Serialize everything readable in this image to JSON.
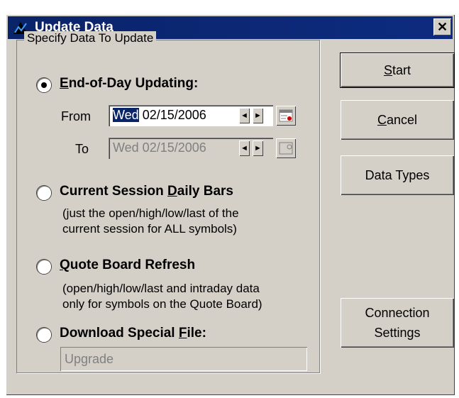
{
  "window": {
    "title": "Update Data",
    "close_glyph": "✕"
  },
  "group": {
    "title": "Specify Data To Update"
  },
  "options": [
    {
      "label_pre": "",
      "label_u": "E",
      "label_post": "nd-of-Day Updating:",
      "selected": true
    },
    {
      "label_pre": "Current Session ",
      "label_u": "D",
      "label_post": "aily Bars",
      "selected": false,
      "desc1": "(just the open/high/low/last of the",
      "desc2": "current session for ALL symbols)"
    },
    {
      "label_pre": "",
      "label_u": "Q",
      "label_post": "uote Board Refresh",
      "selected": false,
      "desc1": "(open/high/low/last and intraday data",
      "desc2": "only for symbols on the Quote Board)"
    },
    {
      "label_pre": "Download Special ",
      "label_u": "F",
      "label_post": "ile:",
      "selected": false
    }
  ],
  "from": {
    "label": "From",
    "day": "Wed",
    "date": " 02/15/2006"
  },
  "to": {
    "label": "To",
    "value": "Wed 02/15/2006"
  },
  "special_file": {
    "value": "Upgrade"
  },
  "buttons": {
    "start_u": "S",
    "start_rest": "tart",
    "cancel_u": "C",
    "cancel_rest": "ancel",
    "data_types": "Data Types",
    "connection_line1": "Connection",
    "connection_line2": "Settings"
  },
  "icons": {
    "app": "app-icon",
    "calendar": "calendar-icon",
    "spin_left": "◄",
    "spin_right": "►"
  }
}
